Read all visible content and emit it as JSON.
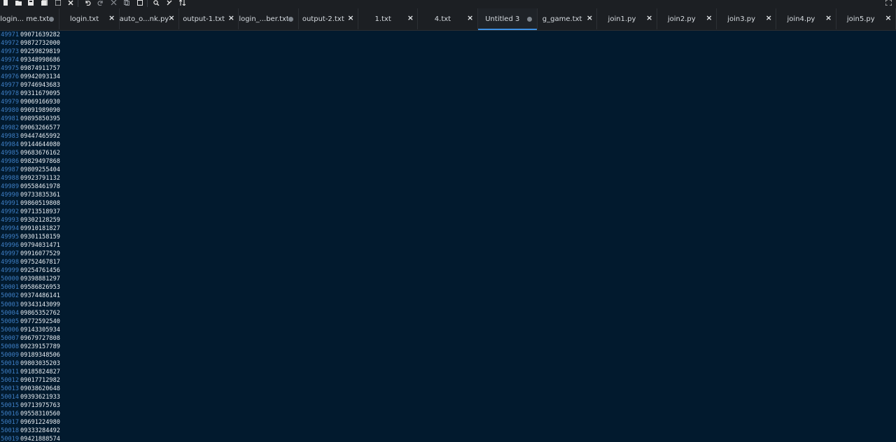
{
  "toolbar": {
    "icons": [
      "new-file-icon",
      "open-file-icon",
      "save-icon",
      "save-all-icon",
      "save-as-icon",
      "close-icon",
      "undo-icon",
      "redo-icon",
      "cut-icon",
      "copy-icon",
      "paste-icon",
      "search-icon",
      "replace-icon",
      "sort-icon",
      "fullscreen-icon"
    ]
  },
  "tabs": [
    {
      "label": "login... me.txt",
      "modified": true,
      "active": false
    },
    {
      "label": "login.txt",
      "modified": false,
      "active": false
    },
    {
      "label": "auto_o...nk.py",
      "modified": false,
      "active": false
    },
    {
      "label": "output-1.txt",
      "modified": false,
      "active": false
    },
    {
      "label": "login_...ber.txt",
      "modified": true,
      "active": false
    },
    {
      "label": "output-2.txt",
      "modified": false,
      "active": false
    },
    {
      "label": "1.txt",
      "modified": false,
      "active": false
    },
    {
      "label": "4.txt",
      "modified": false,
      "active": false
    },
    {
      "label": "Untitled 3",
      "modified": true,
      "active": true
    },
    {
      "label": "g_game.txt",
      "modified": false,
      "active": false
    },
    {
      "label": "join1.py",
      "modified": false,
      "active": false
    },
    {
      "label": "join2.py",
      "modified": false,
      "active": false
    },
    {
      "label": "join3.py",
      "modified": false,
      "active": false
    },
    {
      "label": "join4.py",
      "modified": false,
      "active": false
    },
    {
      "label": "join5.py",
      "modified": false,
      "active": false
    }
  ],
  "editor": {
    "lines": [
      {
        "n": "49971",
        "t": "09071639282"
      },
      {
        "n": "49972",
        "t": "09872732000"
      },
      {
        "n": "49973",
        "t": "09259829819"
      },
      {
        "n": "49974",
        "t": "09348998686"
      },
      {
        "n": "49975",
        "t": "09874911757"
      },
      {
        "n": "49976",
        "t": "09942093134"
      },
      {
        "n": "49977",
        "t": "09746943683"
      },
      {
        "n": "49978",
        "t": "09311679095"
      },
      {
        "n": "49979",
        "t": "09069166930"
      },
      {
        "n": "49980",
        "t": "09091989090"
      },
      {
        "n": "49981",
        "t": "09895850395"
      },
      {
        "n": "49982",
        "t": "09063266577"
      },
      {
        "n": "49983",
        "t": "09447465992"
      },
      {
        "n": "49984",
        "t": "09144644080"
      },
      {
        "n": "49985",
        "t": "09683676162"
      },
      {
        "n": "49986",
        "t": "09829497868"
      },
      {
        "n": "49987",
        "t": "09809255404"
      },
      {
        "n": "49988",
        "t": "09923791132"
      },
      {
        "n": "49989",
        "t": "09558461978"
      },
      {
        "n": "49990",
        "t": "09733835361"
      },
      {
        "n": "49991",
        "t": "09860519808"
      },
      {
        "n": "49992",
        "t": "09713518937"
      },
      {
        "n": "49993",
        "t": "09302128259"
      },
      {
        "n": "49994",
        "t": "09910181827"
      },
      {
        "n": "49995",
        "t": "09301158159"
      },
      {
        "n": "49996",
        "t": "09794031471"
      },
      {
        "n": "49997",
        "t": "09916077529"
      },
      {
        "n": "49998",
        "t": "09752467817"
      },
      {
        "n": "49999",
        "t": "09254761456"
      },
      {
        "n": "50000",
        "t": "09398881297"
      },
      {
        "n": "50001",
        "t": "09586826953"
      },
      {
        "n": "50002",
        "t": "09374486141"
      },
      {
        "n": "50003",
        "t": "09343143099"
      },
      {
        "n": "50004",
        "t": "09865352762"
      },
      {
        "n": "50005",
        "t": "09772592540"
      },
      {
        "n": "50006",
        "t": "09143305934"
      },
      {
        "n": "50007",
        "t": "09679727808"
      },
      {
        "n": "50008",
        "t": "09239157789"
      },
      {
        "n": "50009",
        "t": "09189348506"
      },
      {
        "n": "50010",
        "t": "09803035203"
      },
      {
        "n": "50011",
        "t": "09185824827"
      },
      {
        "n": "50012",
        "t": "09017712982"
      },
      {
        "n": "50013",
        "t": "09038620648"
      },
      {
        "n": "50014",
        "t": "09393621933"
      },
      {
        "n": "50015",
        "t": "09713975763"
      },
      {
        "n": "50016",
        "t": "09558310560"
      },
      {
        "n": "50017",
        "t": "09691224980"
      },
      {
        "n": "50018",
        "t": "09333284492"
      },
      {
        "n": "50019",
        "t": "09421888574"
      }
    ]
  },
  "colors": {
    "editor_bg": "#021a2e",
    "line_number": "#3e7fc6",
    "text": "#e8edf2",
    "tabbar_bg": "#1c1f23",
    "active_tab_accent": "#3d8fe0"
  }
}
